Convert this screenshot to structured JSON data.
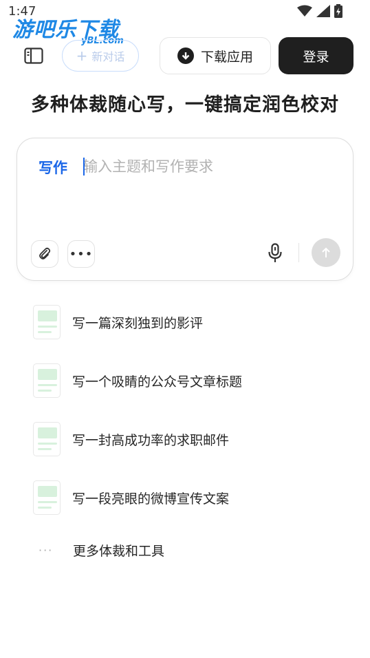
{
  "status_bar": {
    "time": "1:47",
    "icons": [
      "wifi-icon",
      "signal-icon",
      "battery-icon"
    ]
  },
  "watermark": {
    "main": "游吧乐下载",
    "sub": "yBL.com"
  },
  "topbar": {
    "sidebar_toggle_icon": "sidebar-icon",
    "new_chat_label": "新对话",
    "download_app_label": "下载应用",
    "login_label": "登录"
  },
  "headline": "多种体裁随心写，一键搞定润色校对",
  "composer": {
    "mode_label": "写作",
    "input_value": "",
    "input_placeholder": "输入主题和写作要求",
    "icons": [
      "paperclip-icon",
      "more-icon",
      "microphone-icon",
      "send-arrow-icon"
    ]
  },
  "suggestions": [
    {
      "label": "写一篇深刻独到的影评",
      "icon": "document-icon"
    },
    {
      "label": "写一个吸睛的公众号文章标题",
      "icon": "document-icon"
    },
    {
      "label": "写一封高成功率的求职邮件",
      "icon": "document-icon"
    },
    {
      "label": "写一段亮眼的微博宣传文案",
      "icon": "document-icon"
    }
  ],
  "more_tools": {
    "label": "更多体裁和工具",
    "icon": "ellipsis-icon"
  },
  "colors": {
    "accent": "#1a66e8",
    "dark_button": "#1f1f1f",
    "doc_icon_fill": "#d8f1dd",
    "send_disabled": "#dcdcdc"
  }
}
